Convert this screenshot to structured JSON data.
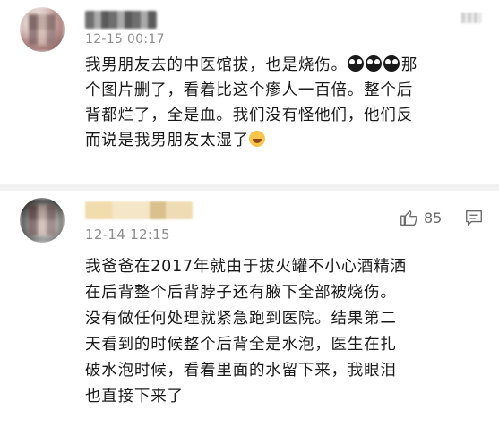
{
  "comments": [
    {
      "timestamp": "12-15 00:17",
      "lines": [
        "我男朋友去的中医馆拔，也是烧伤。",
        "那",
        "个图片删了，看着比这个瘆人一百倍。整个后",
        "背都烂了，全是血。我们没有怪他们，他们反",
        "而说是我男朋友太湿了"
      ]
    },
    {
      "timestamp": "12-14 12:15",
      "like_count": "85",
      "lines": [
        "我爸爸在2017年就由于拔火罐不小心酒精洒",
        "在后背整个后背脖子还有腋下全部被烧伤。",
        "没有做任何处理就紧急跑到医院。结果第二",
        "天看到的时候整个后背全是水泡，医生在扎",
        "破水泡时候，看着里面的水留下来，我眼泪",
        "也直接下来了"
      ]
    }
  ],
  "icons": {
    "emoji_face": "sneaky-face-emoji-icon",
    "emoji_laugh": "laugh-cry-emoji-icon",
    "like": "thumbs-up-icon",
    "reply": "comment-bubble-icon"
  }
}
